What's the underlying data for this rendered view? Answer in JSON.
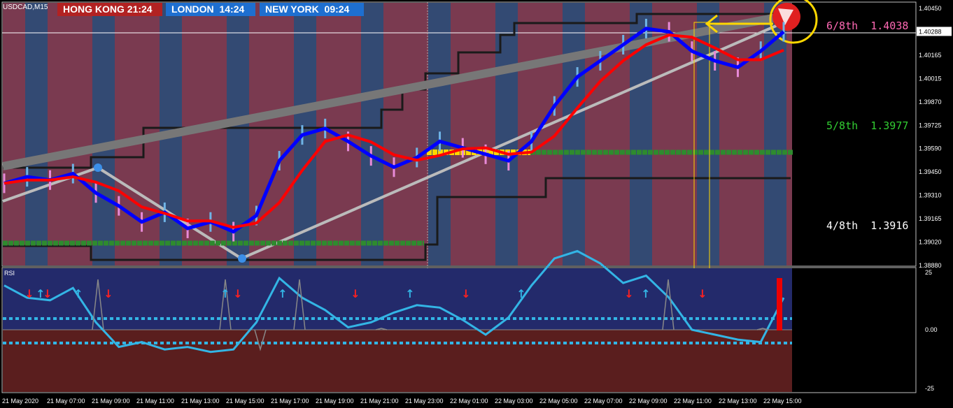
{
  "symbol": "USDCAD,M15",
  "sessions": [
    {
      "city": "HONG KONG",
      "time": "21:24",
      "color": "#b22222"
    },
    {
      "city": "LONDON",
      "time": "14:24",
      "color": "#1e6fd0"
    },
    {
      "city": "NEW YORK",
      "time": "09:24",
      "color": "#1e6fd0"
    }
  ],
  "murrey": [
    {
      "label": "6/8th",
      "value": "1.4038",
      "color": "#ff69b4"
    },
    {
      "label": "5/8th",
      "value": "1.3977",
      "color": "#32cd32"
    },
    {
      "label": "4/8th",
      "value": "1.3916",
      "color": "#ffffff"
    }
  ],
  "colors": {
    "bg": "#000000",
    "bull_zone": "#334a73",
    "bear_zone": "#7a3a50",
    "ma_fast": "#0000ff",
    "ma_slow": "#ff0000",
    "rsi_line": "#33b5e5",
    "rsi_upper_bg": "#232a6b",
    "rsi_lower_bg": "#5a1e1e"
  },
  "chart_data": {
    "type": "line",
    "title": "USDCAD,M15",
    "current_price": "1.40288",
    "y_ticks": [
      "1.40450",
      "1.40288",
      "1.40165",
      "1.40015",
      "1.39870",
      "1.39725",
      "1.39590",
      "1.39450",
      "1.39310",
      "1.39165",
      "1.39020",
      "1.38880"
    ],
    "x_ticks": [
      "21 May 2020",
      "21 May 07:00",
      "21 May 09:00",
      "21 May 11:00",
      "21 May 13:00",
      "21 May 15:00",
      "21 May 17:00",
      "21 May 19:00",
      "21 May 21:00",
      "21 May 23:00",
      "22 May 01:00",
      "22 May 03:00",
      "22 May 05:00",
      "22 May 07:00",
      "22 May 09:00",
      "22 May 11:00",
      "22 May 13:00",
      "22 May 15:00"
    ],
    "ylim": [
      1.3885,
      1.4048
    ],
    "series": [
      {
        "values": [
          1.3936,
          1.394,
          1.3938,
          1.3942,
          1.393,
          1.3922,
          1.3912,
          1.3918,
          1.3908,
          1.3912,
          1.3906,
          1.3916,
          1.395,
          1.3966,
          1.397,
          1.3962,
          1.3953,
          1.3946,
          1.3952,
          1.3962,
          1.3958,
          1.3954,
          1.395,
          1.3962,
          1.3984,
          1.4002,
          1.4012,
          1.4022,
          1.4032,
          1.403,
          1.4018,
          1.4012,
          1.4008,
          1.4018,
          1.403
        ]
      }
    ],
    "rsi": {
      "label": "RSI",
      "y_ticks": [
        "25",
        "0.00",
        "-25"
      ],
      "values": [
        18,
        13,
        12,
        17,
        3,
        -7,
        -5,
        -8,
        -7,
        -9,
        -8,
        3,
        21,
        13,
        8,
        1,
        3,
        7,
        10,
        9,
        4,
        -2,
        5,
        18,
        29,
        32,
        27,
        19,
        22,
        13,
        0,
        -2,
        -4,
        -5,
        13
      ]
    }
  }
}
